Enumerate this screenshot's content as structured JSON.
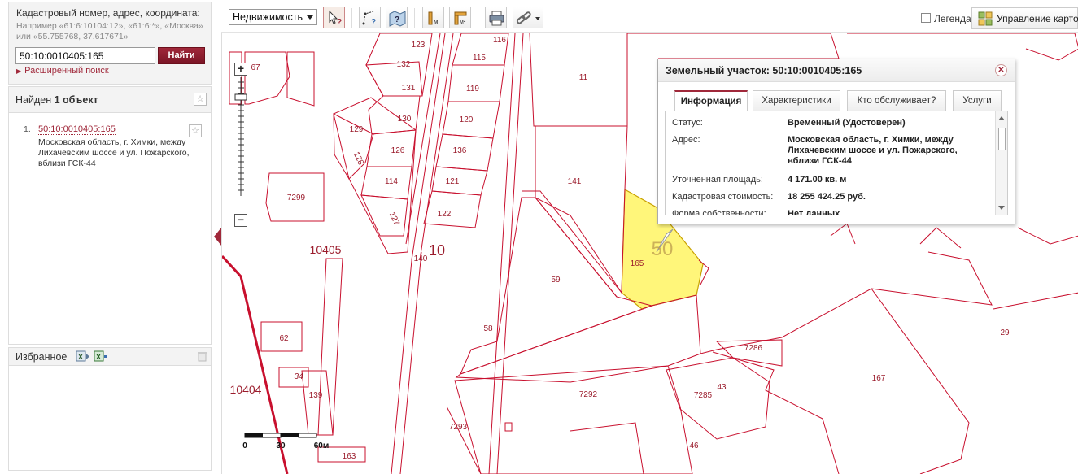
{
  "search": {
    "title": "Кадастровый номер, адрес, координата:",
    "hint": "Например «61:6:10104:12», «61:6:*», «Москва» или «55.755768, 37.617671»",
    "value": "50:10:0010405:165",
    "button": "Найти",
    "advanced_link": "Расширенный поиск"
  },
  "results": {
    "label_prefix": "Найден ",
    "label_count": "1 объект",
    "items": [
      {
        "num": "1.",
        "cadastral": "50:10:0010405:165",
        "address": "Московская область, г. Химки, между Лихачевским шоссе и ул. Пожарского, вблизи ГСК-44"
      }
    ]
  },
  "favorites": {
    "label": "Избранное"
  },
  "toolbar": {
    "type_select": "Недвижимость",
    "legend_label": "Легенда",
    "map_management": "Управление картой"
  },
  "popup": {
    "title": "Земельный участок: 50:10:0010405:165",
    "tabs": [
      "Информация",
      "Характеристики",
      "Кто обслуживает?",
      "Услуги"
    ],
    "active_tab": "Информация",
    "properties": [
      {
        "key": "Статус:",
        "value": "Временный (Удостоверен)"
      },
      {
        "key": "Адрес:",
        "value": "Московская область, г. Химки, между Лихачевским шоссе и ул. Пожарского, вблизи ГСК-44"
      },
      {
        "key": "Уточненная площадь:",
        "value": "4 171.00 кв. м"
      },
      {
        "key": "Кадастровая стоимость:",
        "value": "18 255 424.25 руб."
      },
      {
        "key": "Форма собственности:",
        "value": "Нет данных"
      }
    ]
  },
  "map": {
    "parcel_labels": [
      "123",
      "116",
      "132",
      "115",
      "131",
      "11",
      "119",
      "130",
      "120",
      "129",
      "126",
      "136",
      "128",
      "141",
      "114",
      "121",
      "127",
      "122",
      "7299",
      "67",
      "10405",
      "140",
      "10",
      "165",
      "50",
      "59",
      "62",
      "58",
      "7286",
      "43",
      "167",
      "29",
      "7292",
      "7285",
      "34",
      "139",
      "10404",
      "7293",
      "46",
      "163"
    ],
    "scale": {
      "ticks": [
        "0",
        "30",
        "60м"
      ]
    }
  },
  "colors": {
    "accent": "#a0283a",
    "parcel_line": "#c8102e",
    "selected_fill": "#fff67a",
    "label": "#9b1c2c"
  }
}
